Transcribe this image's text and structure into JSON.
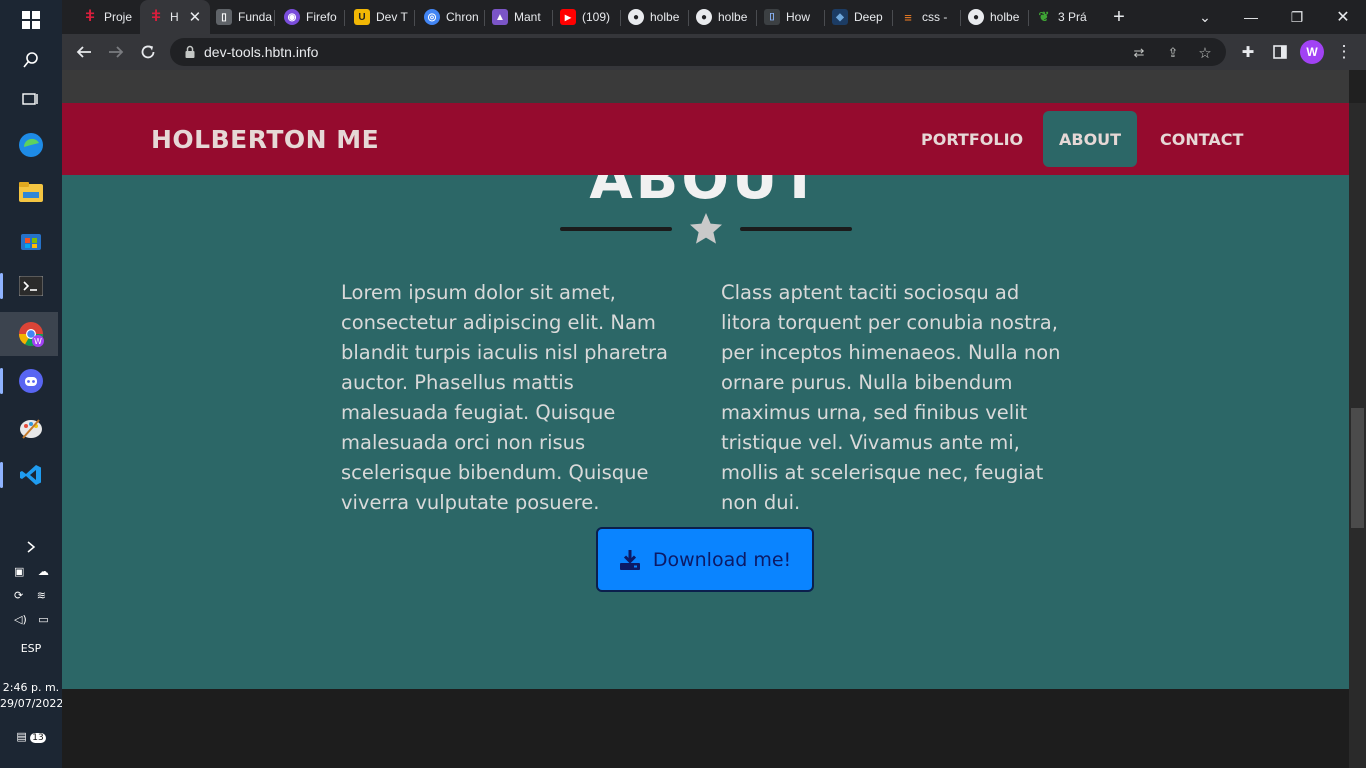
{
  "browser": {
    "tabs": [
      {
        "label": "Proje",
        "fav_color": "#d81e3c",
        "fav_glyph": "ǂ"
      },
      {
        "label": "H",
        "fav_color": "#d81e3c",
        "fav_glyph": "ǂ",
        "active": true
      },
      {
        "label": "Funda",
        "fav_color": "#555",
        "fav_glyph": "▯"
      },
      {
        "label": "Firefo",
        "fav_color": "#7a4ddb",
        "fav_glyph": "◉"
      },
      {
        "label": "Dev T",
        "fav_color": "#f2b705",
        "fav_glyph": "U"
      },
      {
        "label": "Chron",
        "fav_color": "#4285f4",
        "fav_glyph": "◎"
      },
      {
        "label": "Mant",
        "fav_color": "#7b55c7",
        "fav_glyph": "▲"
      },
      {
        "label": "(109)",
        "fav_color": "#ff0000",
        "fav_glyph": "▶"
      },
      {
        "label": "holbe",
        "fav_color": "#202124",
        "fav_glyph": "●"
      },
      {
        "label": "holbe",
        "fav_color": "#202124",
        "fav_glyph": "●"
      },
      {
        "label": "How",
        "fav_color": "#333",
        "fav_glyph": "⌷"
      },
      {
        "label": "Deep",
        "fav_color": "#1c3c64",
        "fav_glyph": "◆"
      },
      {
        "label": "css -",
        "fav_color": "#f48024",
        "fav_glyph": "≡"
      },
      {
        "label": "holbe",
        "fav_color": "#202124",
        "fav_glyph": "●"
      },
      {
        "label": "3 Prá",
        "fav_color": "#3fa535",
        "fav_glyph": "❦"
      }
    ],
    "url": "dev-tools.hbtn.info",
    "profile_initial": "W"
  },
  "site": {
    "brand": "HOLBERTON ME",
    "nav": [
      {
        "label": "PORTFOLIO",
        "active": false
      },
      {
        "label": "ABOUT",
        "active": true
      },
      {
        "label": "CONTACT",
        "active": false
      }
    ],
    "about": {
      "heading": "ABOUT",
      "col_left": "Lorem ipsum dolor sit amet, consectetur adipiscing elit. Nam blandit turpis iaculis nisl pharetra auctor. Phasellus mattis malesuada feugiat. Quisque malesuada orci non risus scelerisque bibendum. Quisque viverra vulputate posuere.",
      "col_right": "Class aptent taciti sociosqu ad litora torquent per conubia nostra, per inceptos himenaeos. Nulla non ornare purus. Nulla bibendum maximus urna, sed finibus velit tristique vel. Vivamus ante mi, mollis at scelerisque nec, feugiat non dui.",
      "download_label": "Download me!"
    }
  },
  "system": {
    "language": "ESP",
    "time": "2:46 p. m.",
    "date": "29/07/2022",
    "notifications": "13"
  },
  "colors": {
    "navbar": "#950b2e",
    "section": "#2c6767",
    "button": "#0a84ff"
  }
}
